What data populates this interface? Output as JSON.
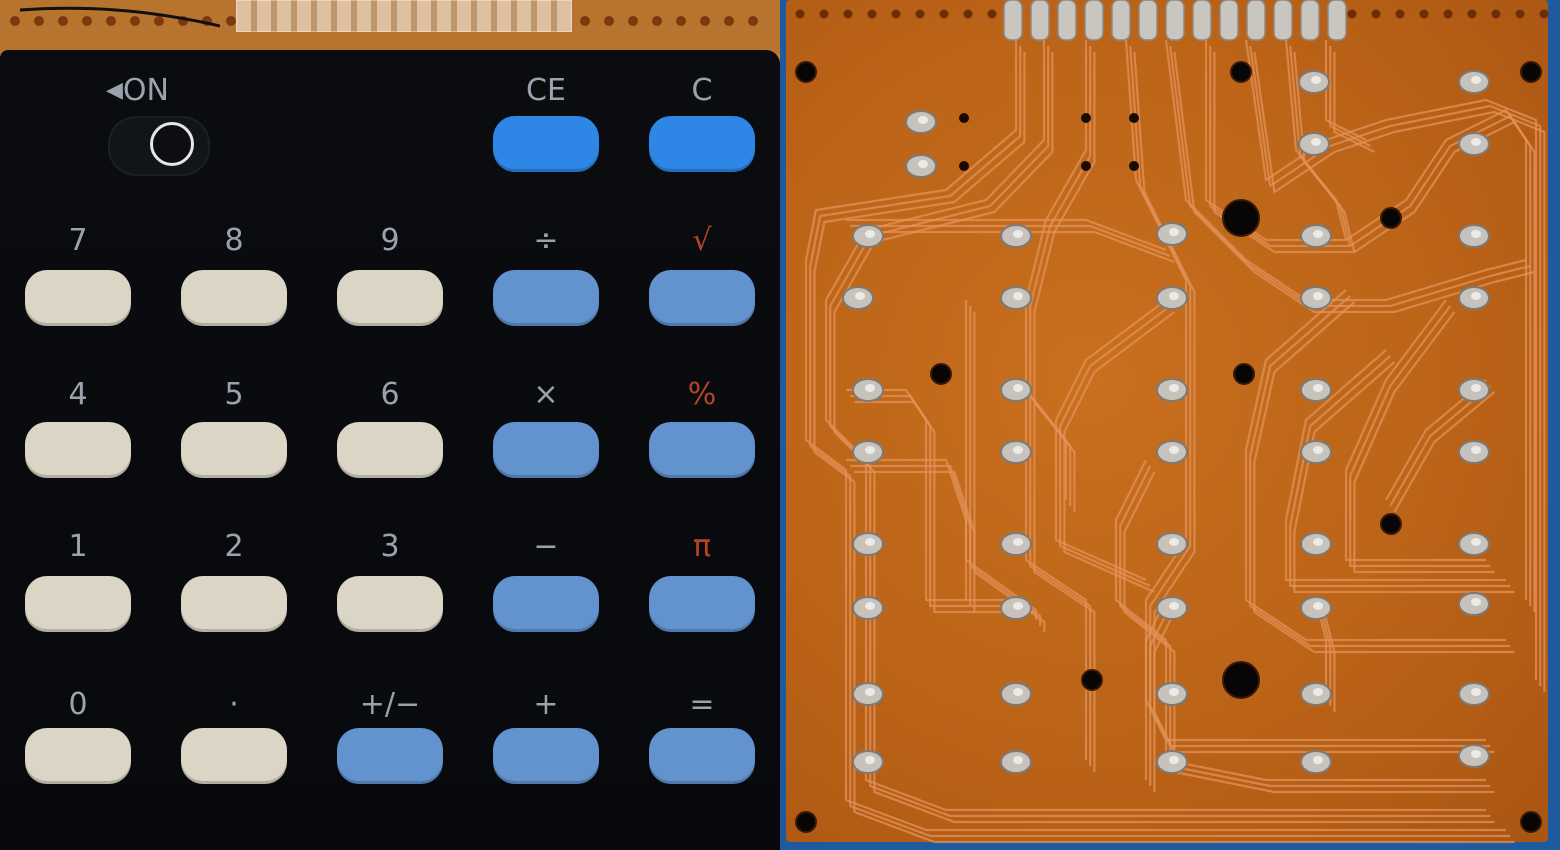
{
  "keypad": {
    "power_label": "ON",
    "keys": [
      {
        "label": "CE",
        "color": "bright",
        "accent": false
      },
      {
        "label": "C",
        "color": "bright",
        "accent": false
      },
      {
        "label": "7",
        "color": "cream",
        "accent": false
      },
      {
        "label": "8",
        "color": "cream",
        "accent": false
      },
      {
        "label": "9",
        "color": "cream",
        "accent": false
      },
      {
        "label": "÷",
        "color": "blue",
        "accent": false
      },
      {
        "label": "√",
        "color": "blue",
        "accent": true
      },
      {
        "label": "4",
        "color": "cream",
        "accent": false
      },
      {
        "label": "5",
        "color": "cream",
        "accent": false
      },
      {
        "label": "6",
        "color": "cream",
        "accent": false
      },
      {
        "label": "×",
        "color": "blue",
        "accent": false
      },
      {
        "label": "%",
        "color": "blue",
        "accent": true
      },
      {
        "label": "1",
        "color": "cream",
        "accent": false
      },
      {
        "label": "2",
        "color": "cream",
        "accent": false
      },
      {
        "label": "3",
        "color": "cream",
        "accent": false
      },
      {
        "label": "−",
        "color": "blue",
        "accent": false
      },
      {
        "label": "π",
        "color": "blue",
        "accent": true
      },
      {
        "label": "0",
        "color": "cream",
        "accent": false
      },
      {
        "label": "·",
        "color": "cream",
        "accent": false
      },
      {
        "label": "+/−",
        "color": "blue",
        "accent": false
      },
      {
        "label": "+",
        "color": "blue",
        "accent": false
      },
      {
        "label": "=",
        "color": "blue",
        "accent": false
      }
    ]
  },
  "colors": {
    "cream_key": "#dbd5c6",
    "blue_key": "#6293cf",
    "bright_blue_key": "#2e86e6",
    "label_grey": "#9aa3ad",
    "label_red": "#b34428",
    "pcb_copper": "#c0661a",
    "background_blue": "#1f5aa0"
  }
}
